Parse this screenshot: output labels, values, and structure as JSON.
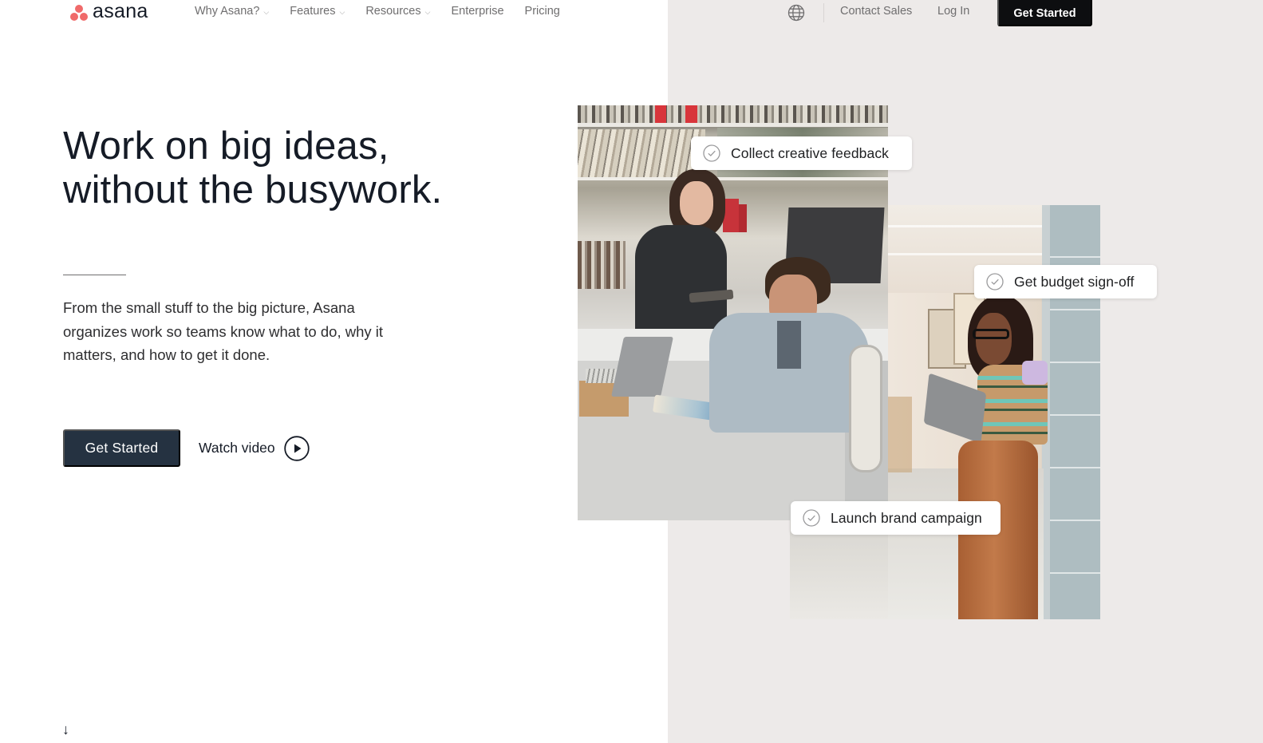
{
  "nav": {
    "logo_text": "asana",
    "links": [
      {
        "label": "Why Asana?",
        "has_dropdown": true,
        "chevron": "chevron-down-icon"
      },
      {
        "label": "Features",
        "has_dropdown": true,
        "chevron": "chevron-down-icon"
      },
      {
        "label": "Resources",
        "has_dropdown": true,
        "chevron": "chevron-down-icon"
      },
      {
        "label": "Enterprise",
        "has_dropdown": false
      },
      {
        "label": "Pricing",
        "has_dropdown": false
      }
    ],
    "chevron_glyph": "⌵",
    "globe_icon": "globe-icon",
    "contact_sales": "Contact Sales",
    "log_in": "Log In",
    "cta": "Get Started"
  },
  "hero": {
    "title_lines": [
      "Work on big ideas,",
      "without the busywork."
    ],
    "subtitle": "From the small stuff to the big picture, Asana organizes work so teams know what to do, why it matters, and how to get it done.",
    "cta": "Get Started",
    "watch_video": "Watch video",
    "scroll_arrow": "↓"
  },
  "task_cards": [
    {
      "label": "Collect creative feedback",
      "icon": "check-circle-icon"
    },
    {
      "label": "Get budget sign-off",
      "icon": "check-circle-icon"
    },
    {
      "label": "Launch brand campaign",
      "icon": "check-circle-icon"
    }
  ],
  "colors": {
    "brand_coral": "#f06a6a",
    "nav_cta_bg": "#0d0e10",
    "hero_cta_bg": "#253241",
    "right_panel_bg": "#edeae9",
    "text_primary": "#151b26",
    "text_muted": "#6f6e6f"
  }
}
